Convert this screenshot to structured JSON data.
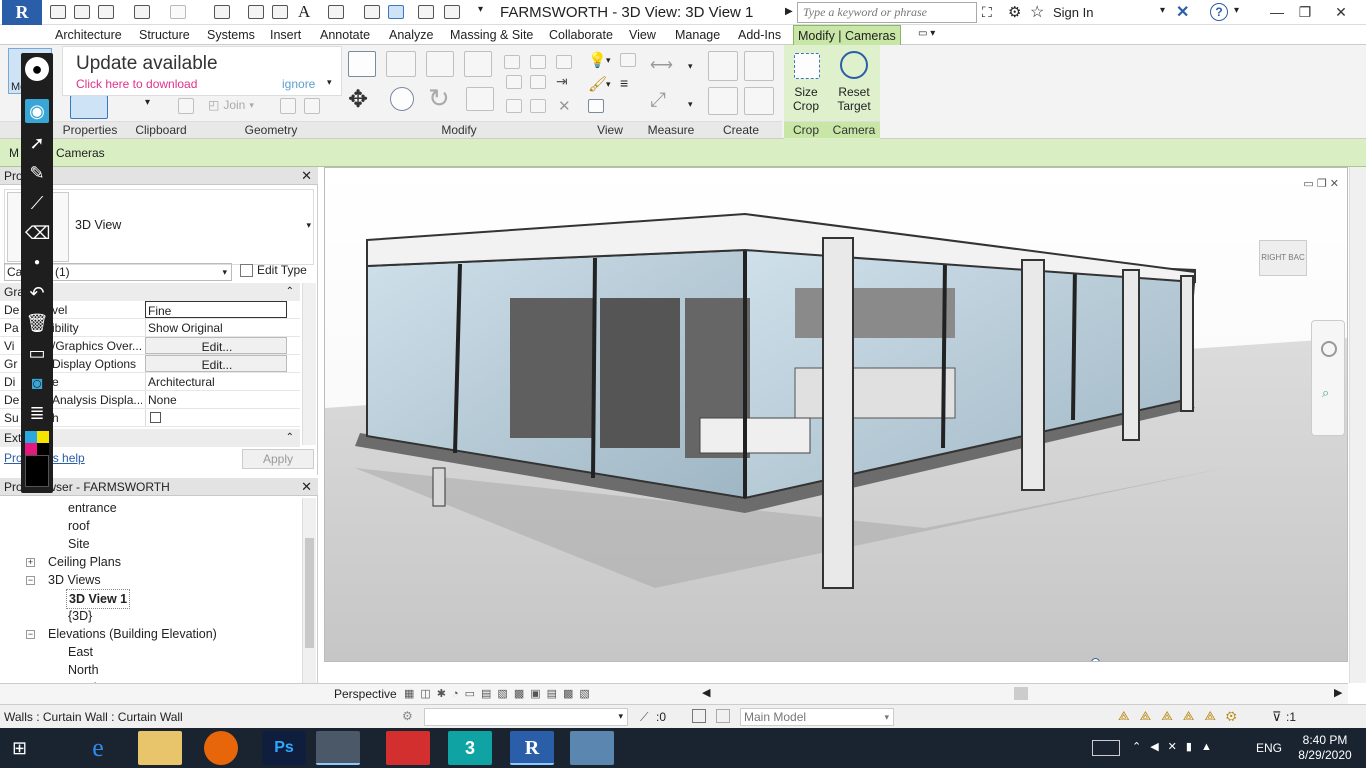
{
  "window": {
    "title": "FARMSWORTH - 3D View: 3D View 1",
    "app_logo": "R",
    "search_placeholder": "Type a keyword or phrase",
    "signin": "Sign In"
  },
  "tabs": [
    "Architecture",
    "Structure",
    "Systems",
    "Insert",
    "Annotate",
    "Analyze",
    "Massing & Site",
    "Collaborate",
    "View",
    "Manage",
    "Add-Ins",
    "Modify | Cameras"
  ],
  "ribbon": {
    "modify_label": "Modify",
    "panels": [
      "Properties",
      "Clipboard",
      "Geometry",
      "Modify",
      "View",
      "Measure",
      "Create",
      "Crop",
      "Camera"
    ],
    "join_label": "Join",
    "crop": {
      "size_crop": "Size Crop",
      "reset_target": "Reset Target"
    }
  },
  "update": {
    "title": "Update available",
    "link": "Click here to download",
    "ignore": "ignore"
  },
  "context_bar": {
    "label_left": "M",
    "label": "Cameras"
  },
  "properties": {
    "title": "Pro",
    "type_name": "3D View",
    "category": "Ca",
    "category_count": "(1)",
    "edit_type": "Edit Type",
    "section": "Gra",
    "rows": [
      {
        "key_prefix": "De",
        "key": "vel",
        "value": "Fine"
      },
      {
        "key_prefix": "Pa",
        "key": "ibility",
        "value": "Show Original"
      },
      {
        "key_prefix": "Vi",
        "key": "/Graphics Over...",
        "value": "Edit..."
      },
      {
        "key_prefix": "Gr",
        "key": "Display Options",
        "value": "Edit..."
      },
      {
        "key_prefix": "Di",
        "key": "e",
        "value": "Architectural"
      },
      {
        "key_prefix": "De",
        "key": "Analysis Displa...",
        "value": "None"
      },
      {
        "key_prefix": "Su",
        "key": "h",
        "value": ""
      }
    ],
    "ext_label": "Ext",
    "help_link": "Pro",
    "help_link_rest": "s help",
    "apply": "Apply"
  },
  "browser": {
    "title_prefix": "Pro",
    "title": "owser - FARMSWORTH",
    "items": [
      {
        "label": "entrance",
        "level": 3,
        "bold": false
      },
      {
        "label": "roof",
        "level": 3,
        "bold": false
      },
      {
        "label": "Site",
        "level": 3,
        "bold": false
      },
      {
        "label": "Ceiling Plans",
        "level": 2,
        "bold": false,
        "expander": "+"
      },
      {
        "label": "3D Views",
        "level": 2,
        "bold": false,
        "expander": "-"
      },
      {
        "label": "3D View 1",
        "level": 3,
        "bold": true
      },
      {
        "label": "{3D}",
        "level": 3,
        "bold": false
      },
      {
        "label": "Elevations (Building Elevation)",
        "level": 2,
        "bold": false,
        "expander": "-"
      },
      {
        "label": "East",
        "level": 3,
        "bold": false
      },
      {
        "label": "North",
        "level": 3,
        "bold": false
      },
      {
        "label": "South",
        "level": 3,
        "bold": false
      }
    ]
  },
  "viewport": {
    "viewcube_face": "RIGHT",
    "viewcube_face2": "BAC"
  },
  "view_control": {
    "mode": "Perspective"
  },
  "status": {
    "selection": "Walls : Curtain Wall : Curtain Wall",
    "count": ":0",
    "model": "Main Model",
    "filter_count": ":1"
  },
  "taskbar": {
    "language": "ENG",
    "time": "8:40 PM",
    "date": "8/29/2020"
  },
  "colors": {
    "accent_blue": "#2b5ea8",
    "context_green": "#c8e6a6",
    "taskbar": "#1a2430"
  }
}
